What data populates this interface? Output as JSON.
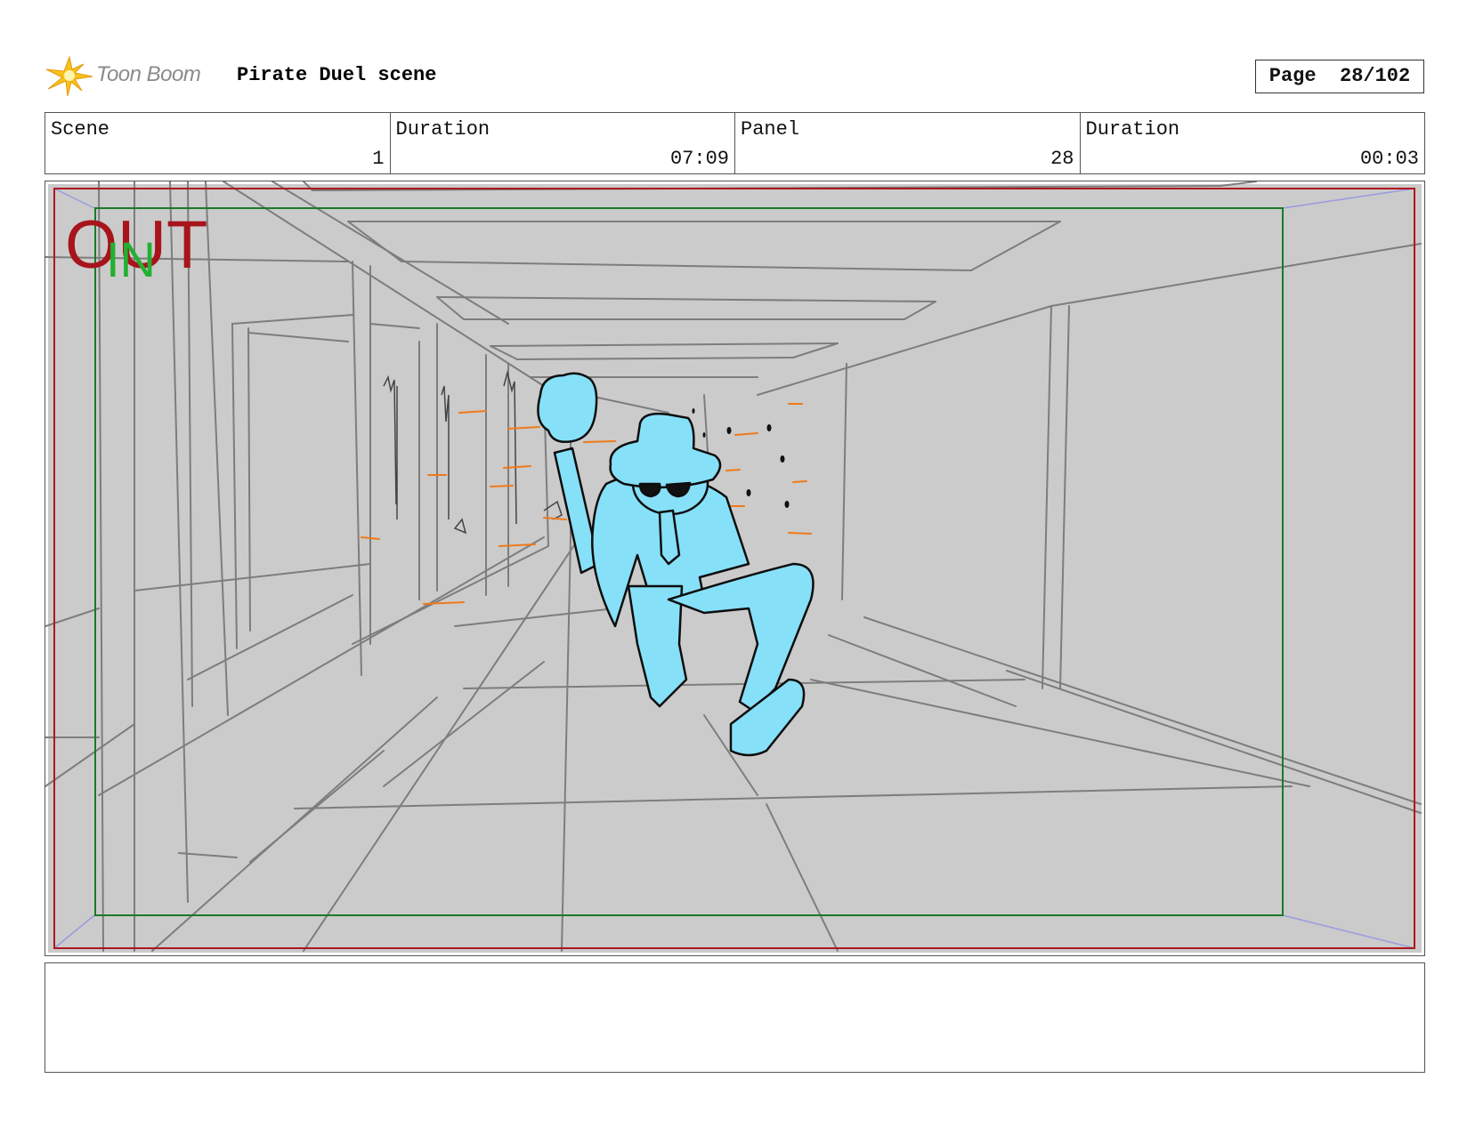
{
  "header": {
    "logo_text": "Toon Boom",
    "project_title": "Pirate Duel scene",
    "page_label": "Page",
    "page_number": "28/102"
  },
  "info": {
    "scene_label": "Scene",
    "scene_value": "1",
    "scene_duration_label": "Duration",
    "scene_duration_value": "07:09",
    "panel_label": "Panel",
    "panel_value": "28",
    "panel_duration_label": "Duration",
    "panel_duration_value": "00:03"
  },
  "panel": {
    "out_label": "OUT",
    "in_label": "IN"
  },
  "notes": {
    "text": ""
  },
  "colors": {
    "out_frame": "#b0161e",
    "in_frame": "#1a7a2a",
    "character_fill": "#86e0f8",
    "effects": "#f07a1a",
    "background": "#cbcbcb"
  }
}
